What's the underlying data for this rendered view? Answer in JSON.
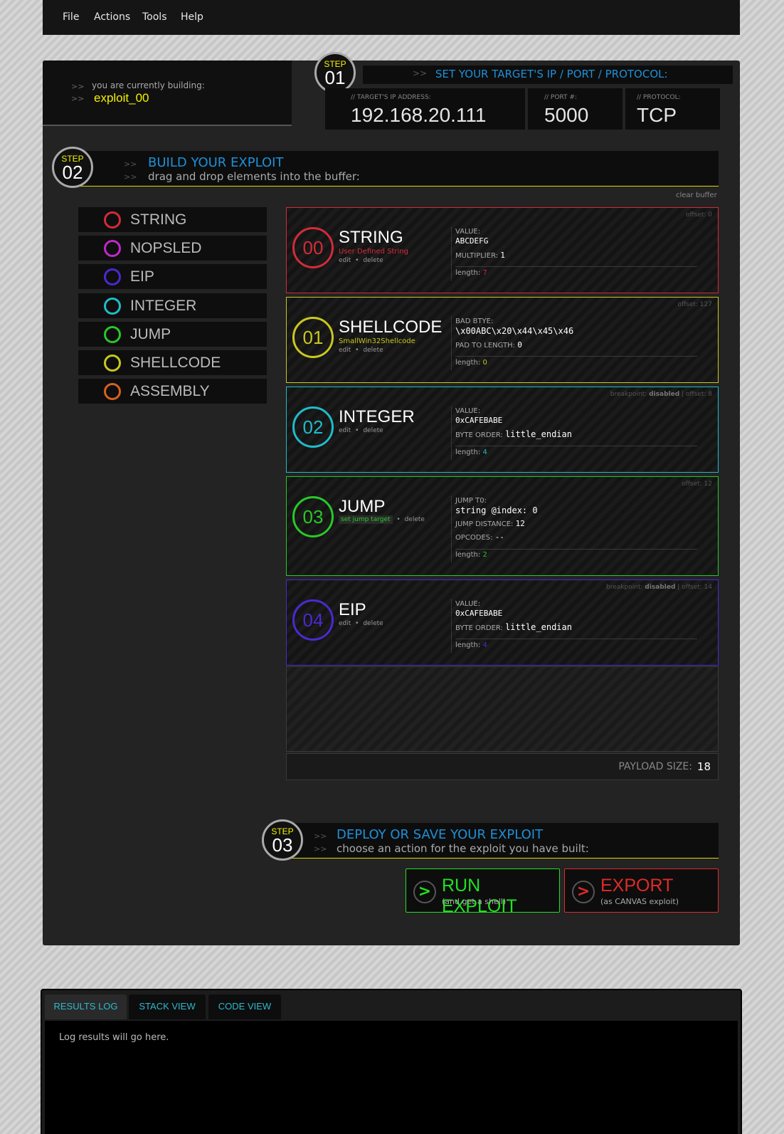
{
  "menu": {
    "items": [
      "File",
      "Actions",
      "Tools",
      "Help"
    ]
  },
  "building": {
    "arrow": ">>",
    "label": "you are currently building:",
    "name": "exploit_00"
  },
  "step1": {
    "step": "STEP",
    "number": "01",
    "arrow": ">>",
    "title": "SET YOUR TARGET'S IP / PORT / PROTOCOL:",
    "ip_label": "// TARGET'S IP ADDRESS:",
    "ip": "192.168.20.111",
    "port_label": "// PORT #:",
    "port": "5000",
    "protocol_label": "// PROTOCOL:",
    "protocol": "TCP"
  },
  "step2": {
    "step": "STEP",
    "number": "02",
    "arrow": ">>",
    "title": "BUILD YOUR EXPLOIT",
    "subtitle": "drag and drop elements into the buffer:",
    "clear_buffer": "clear buffer"
  },
  "palette": [
    {
      "label": "STRING",
      "color": "#d42a3a"
    },
    {
      "label": "NOPSLED",
      "color": "#c028c8"
    },
    {
      "label": "EIP",
      "color": "#4a2ad0"
    },
    {
      "label": "INTEGER",
      "color": "#20bcc8"
    },
    {
      "label": "JUMP",
      "color": "#28c828"
    },
    {
      "label": "SHELLCODE",
      "color": "#c8c820"
    },
    {
      "label": "ASSEMBLY",
      "color": "#d86020"
    }
  ],
  "blocks": [
    {
      "index": "00",
      "name": "STRING",
      "color": "#d42a3a",
      "subtitle": "User Defined String",
      "edit": "edit",
      "bullet": "•",
      "delete": "delete",
      "offset": "offset: 0",
      "f1_label": "VALUE:",
      "f1_value": "ABCDEFG",
      "f2_label": "MULTIPLIER:",
      "f2_value": "1",
      "length_label": "length:",
      "length": "7"
    },
    {
      "index": "01",
      "name": "SHELLCODE",
      "color": "#c8c820",
      "subtitle": "SmallWin32Shellcode",
      "edit": "edit",
      "bullet": "•",
      "delete": "delete",
      "offset": "offset: 127",
      "f1_label": "BAD BTYE:",
      "f1_value": "\\x00ABC\\x20\\x44\\x45\\x46",
      "f2_label": "PAD TO LENGTH:",
      "f2_value": "0",
      "length_label": "length:",
      "length": "0"
    },
    {
      "index": "02",
      "name": "INTEGER",
      "color": "#20bcc8",
      "edit": "edit",
      "bullet": "•",
      "delete": "delete",
      "bp_label": "breakpoint:",
      "bp_value": "disabled",
      "offset": "| offset: 8",
      "f1_label": "VALUE:",
      "f1_value": "0xCAFEBABE",
      "f2_label": "BYTE ORDER:",
      "f2_value": "little_endian",
      "length_label": "length:",
      "length": "4"
    },
    {
      "index": "03",
      "name": "JUMP",
      "color": "#28c828",
      "set_target": "set jump target",
      "bullet": "•",
      "delete": "delete",
      "offset": "offset: 12",
      "f1_label": "JUMP T0:",
      "f1_value": "string @index: 0",
      "f2_label": "JUMP DISTANCE:",
      "f2_value": "12",
      "f3_label": "OPCODES:",
      "f3_value": "--",
      "length_label": "length:",
      "length": "2"
    },
    {
      "index": "04",
      "name": "EIP",
      "color": "#4a2ad0",
      "edit": "edit",
      "bullet": "•",
      "delete": "delete",
      "bp_label": "breakpoint:",
      "bp_value": "disabled",
      "offset": "| offset: 14",
      "f1_label": "VALUE:",
      "f1_value": "0xCAFEBABE",
      "f2_label": "BYTE ORDER:",
      "f2_value": "little_endian",
      "length_label": "length:",
      "length": "4"
    }
  ],
  "payload": {
    "label": "PAYLOAD SIZE:",
    "value": "18"
  },
  "step3": {
    "step": "STEP",
    "number": "03",
    "arrow": ">>",
    "title": "DEPLOY OR SAVE YOUR EXPLOIT",
    "subtitle": "choose an action for the exploit you have built:"
  },
  "actions": {
    "run": {
      "icon": ">",
      "label": "RUN EXPLOIT",
      "sub": "(and get a shell)",
      "color": "#22e022"
    },
    "export": {
      "icon": ">",
      "label": "EXPORT",
      "sub": "(as CANVAS exploit)",
      "color": "#e02a2a"
    }
  },
  "results": {
    "tabs": [
      "RESULTS LOG",
      "STACK VIEW",
      "CODE VIEW"
    ],
    "log_text": "Log results will go here."
  }
}
